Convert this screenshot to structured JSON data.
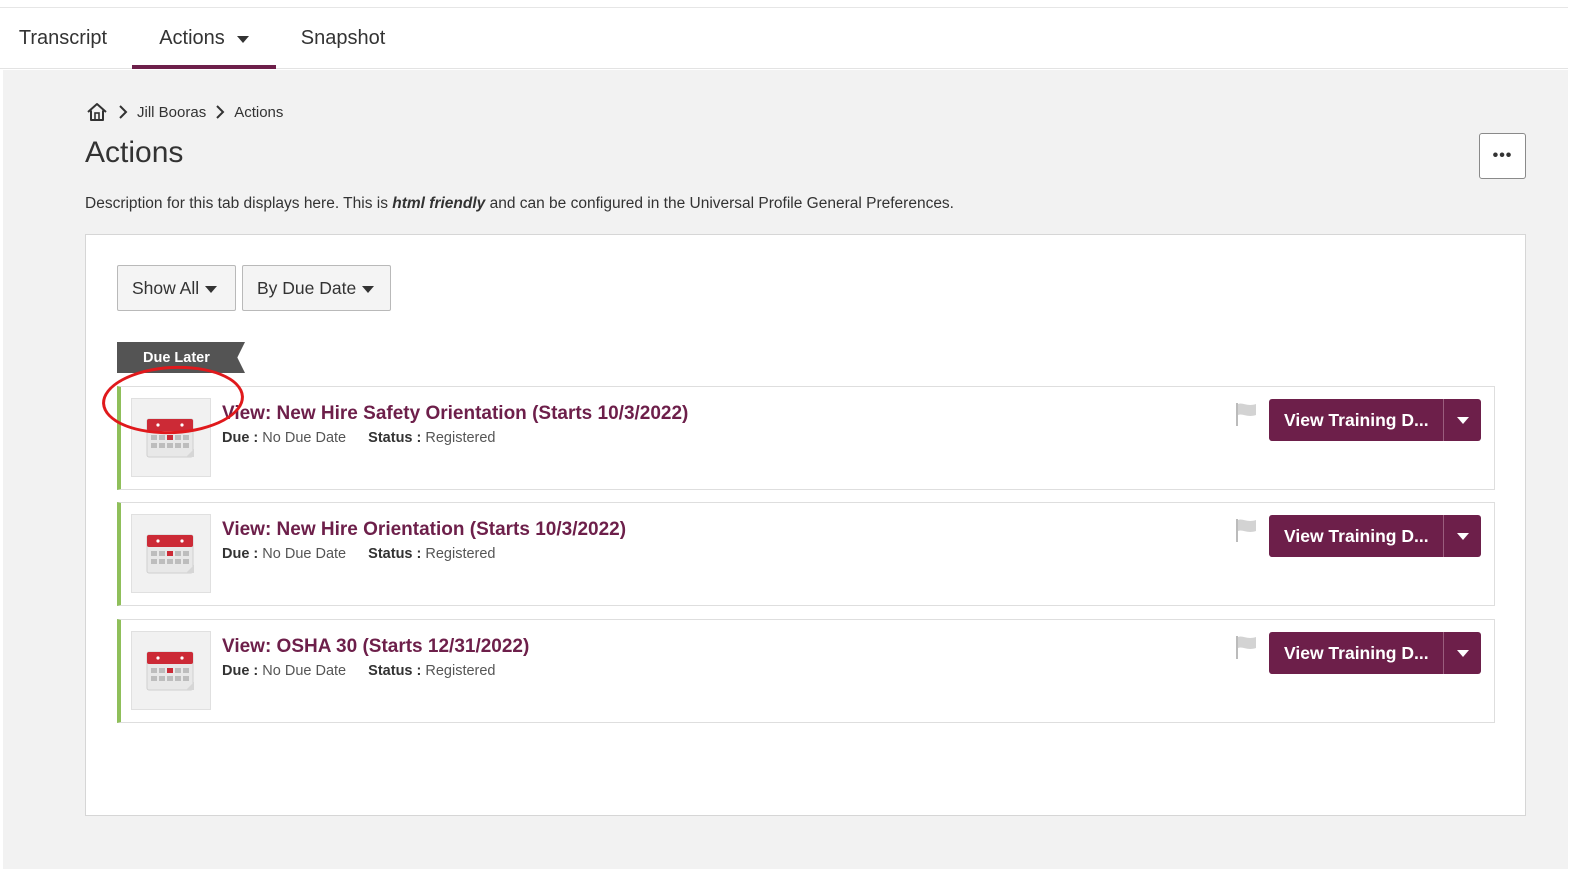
{
  "tabs": [
    {
      "label": "Transcript"
    },
    {
      "label": "Actions"
    },
    {
      "label": "Snapshot"
    }
  ],
  "breadcrumb": {
    "items": [
      {
        "label": "Jill Booras"
      },
      {
        "label": "Actions"
      }
    ]
  },
  "page": {
    "title": "Actions",
    "more_label": "•••",
    "description_before": "Description for this tab displays here. This is ",
    "description_em": "html friendly",
    "description_after": " and can be configured in the Universal Profile General Preferences."
  },
  "filters": {
    "show_label": "Show All",
    "sort_label": "By Due Date"
  },
  "group": {
    "label": "Due Later"
  },
  "items": [
    {
      "title": "View: New Hire Safety Orientation (Starts 10/3/2022)",
      "due_label": "Due :",
      "due_value": "No Due Date",
      "status_label": "Status :",
      "status_value": "Registered",
      "action_label": "View Training D..."
    },
    {
      "title": "View: New Hire Orientation (Starts 10/3/2022)",
      "due_label": "Due :",
      "due_value": "No Due Date",
      "status_label": "Status :",
      "status_value": "Registered",
      "action_label": "View Training D..."
    },
    {
      "title": "View: OSHA 30 (Starts 12/31/2022)",
      "due_label": "Due :",
      "due_value": "No Due Date",
      "status_label": "Status :",
      "status_value": "Registered",
      "action_label": "View Training D..."
    }
  ],
  "colors": {
    "brand": "#6d1f4a",
    "card_accent": "#8fbf5a",
    "tag_bg": "#545454",
    "annotation": "#e0191c"
  },
  "icons": [
    "home-icon",
    "chevron-right-icon",
    "calendar-icon",
    "flag-icon",
    "caret-down-icon"
  ]
}
